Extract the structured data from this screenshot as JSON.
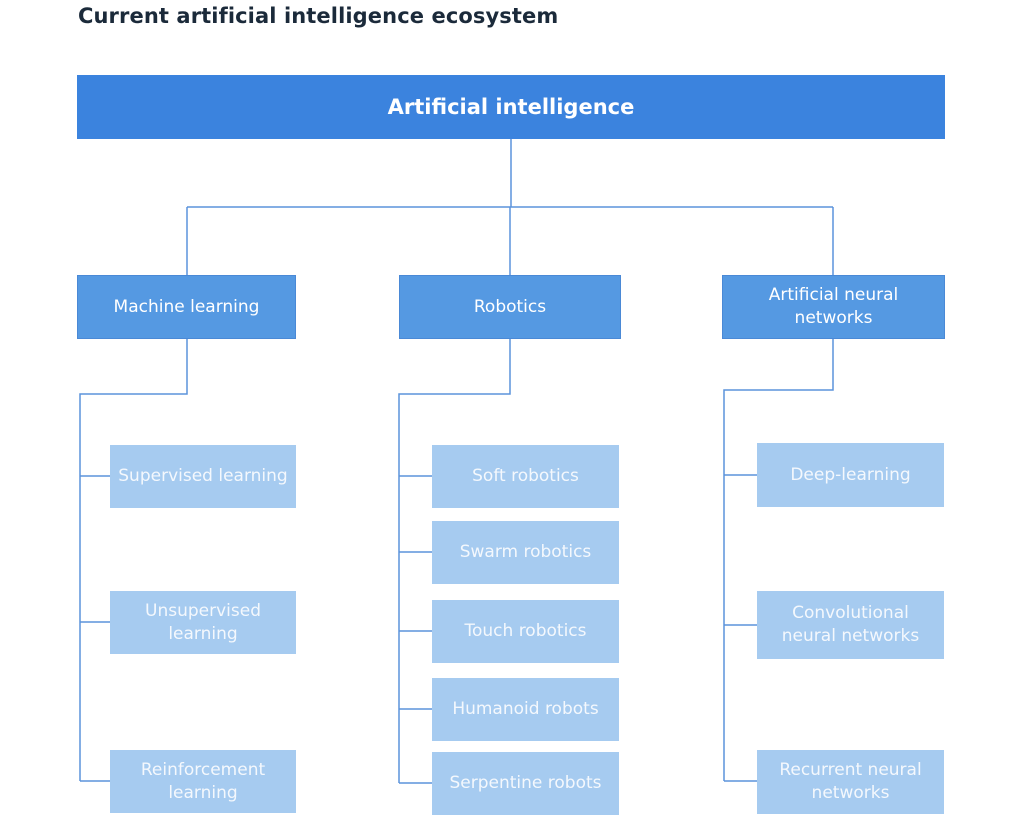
{
  "title": "Current artificial intelligence ecosystem",
  "root": {
    "label": "Artificial intelligence"
  },
  "colors": {
    "root": "#3b83de",
    "category": "#5599e2",
    "leaf": "#a6cbf0",
    "connector": "#5b93dc",
    "title_text": "#1b2a3a"
  },
  "categories": [
    {
      "label": "Machine learning",
      "children": [
        {
          "label": "Supervised learning"
        },
        {
          "label": "Unsupervised learning"
        },
        {
          "label": "Reinforcement learning"
        }
      ]
    },
    {
      "label": "Robotics",
      "children": [
        {
          "label": "Soft robotics"
        },
        {
          "label": "Swarm robotics"
        },
        {
          "label": "Touch robotics"
        },
        {
          "label": "Humanoid robots"
        },
        {
          "label": "Serpentine robots"
        }
      ]
    },
    {
      "label": "Artificial neural networks",
      "children": [
        {
          "label": "Deep-learning"
        },
        {
          "label": "Convolutional neural networks"
        },
        {
          "label": "Recurrent neural networks"
        }
      ]
    }
  ]
}
